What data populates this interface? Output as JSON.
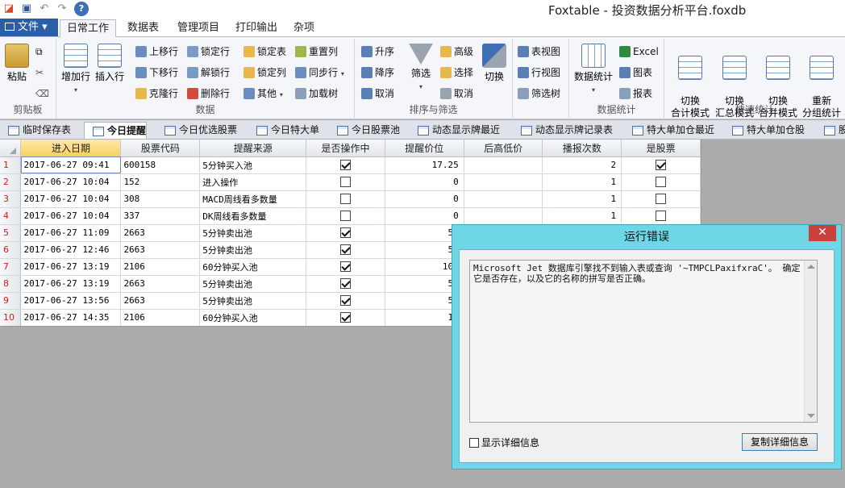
{
  "window": {
    "title": "Foxtable - 投资数据分析平台.foxdb"
  },
  "quick_access": {
    "icons": [
      "app-icon",
      "save-icon",
      "undo-icon",
      "redo-icon",
      "help-icon"
    ]
  },
  "ribbon_tabs": {
    "file": "文件",
    "tabs": [
      "日常工作",
      "数据表",
      "管理项目",
      "打印输出",
      "杂项"
    ],
    "active": "日常工作"
  },
  "ribbon": {
    "clipboard": {
      "label": "剪贴板",
      "paste": "粘贴"
    },
    "data": {
      "label": "数据",
      "add_row": "增加行",
      "insert_row": "插入行",
      "move_up": "上移行",
      "move_down": "下移行",
      "clone_row": "克隆行",
      "lock_row": "锁定行",
      "unlock_row": "解锁行",
      "delete_row": "删除行",
      "lock_table": "锁定表",
      "lock_col": "锁定列",
      "other": "其他",
      "reset_col": "重置列",
      "sync_row": "同步行",
      "load_tree": "加载树"
    },
    "sort_filter": {
      "label": "排序与筛选",
      "asc": "升序",
      "desc": "降序",
      "cancel": "取消",
      "filter": "筛选",
      "advanced": "高级",
      "select": "选择",
      "cancel2": "取消",
      "toggle": "切换"
    },
    "views": {
      "table_view": "表视图",
      "row_view": "行视图",
      "filter_tree": "筛选树"
    },
    "stats": {
      "label": "数据统计",
      "data_stats": "数据统计",
      "excel": "Excel",
      "chart": "图表",
      "report": "报表"
    },
    "quick_stats": {
      "label": "快速统计",
      "total_mode": "切换\n合计模式",
      "summary_mode": "切换\n汇总模式",
      "merge_mode": "切换\n合并模式",
      "regroup": "重新\n分组统计"
    }
  },
  "doc_tabs": [
    "临时保存表",
    "今日提醒",
    "今日优选股票",
    "今日特大单",
    "今日股票池",
    "动态显示牌最近",
    "动态显示牌记录表",
    "特大单加仓最近",
    "特大单加仓股",
    "股"
  ],
  "doc_tab_active": "今日提醒",
  "grid": {
    "columns": [
      "进入日期",
      "股票代码",
      "提醒来源",
      "是否操作中",
      "提醒价位",
      "后高低价",
      "播报次数",
      "是股票"
    ],
    "rows": [
      {
        "n": "1",
        "date": "2017-06-27 09:41",
        "code": "600158",
        "source": "5分钟买入池",
        "op": true,
        "price": "17.25",
        "hl": "",
        "count": "2",
        "stock": true
      },
      {
        "n": "2",
        "date": "2017-06-27 10:04",
        "code": "152",
        "source": "进入操作",
        "op": false,
        "price": "0",
        "hl": "",
        "count": "1",
        "stock": false
      },
      {
        "n": "3",
        "date": "2017-06-27 10:04",
        "code": "308",
        "source": "MACD周线看多数量",
        "op": false,
        "price": "0",
        "hl": "",
        "count": "1",
        "stock": false
      },
      {
        "n": "4",
        "date": "2017-06-27 10:04",
        "code": "337",
        "source": "DK周线看多数量",
        "op": false,
        "price": "0",
        "hl": "",
        "count": "1",
        "stock": false
      },
      {
        "n": "5",
        "date": "2017-06-27 11:09",
        "code": "2663",
        "source": "5分钟卖出池",
        "op": true,
        "price": "5.",
        "hl": "",
        "count": "",
        "stock": null
      },
      {
        "n": "6",
        "date": "2017-06-27 12:46",
        "code": "2663",
        "source": "5分钟卖出池",
        "op": true,
        "price": "5.",
        "hl": "",
        "count": "",
        "stock": null
      },
      {
        "n": "7",
        "date": "2017-06-27 13:19",
        "code": "2106",
        "source": "60分钟买入池",
        "op": true,
        "price": "10.",
        "hl": "",
        "count": "",
        "stock": null
      },
      {
        "n": "8",
        "date": "2017-06-27 13:19",
        "code": "2663",
        "source": "5分钟卖出池",
        "op": true,
        "price": "5.",
        "hl": "",
        "count": "",
        "stock": null
      },
      {
        "n": "9",
        "date": "2017-06-27 13:56",
        "code": "2663",
        "source": "5分钟卖出池",
        "op": true,
        "price": "5.",
        "hl": "",
        "count": "",
        "stock": null
      },
      {
        "n": "10",
        "date": "2017-06-27 14:35",
        "code": "2106",
        "source": "60分钟买入池",
        "op": true,
        "price": "10",
        "hl": "",
        "count": "",
        "stock": null
      }
    ]
  },
  "dialog": {
    "title": "运行错误",
    "close": "✕",
    "message": "Microsoft Jet 数据库引擎找不到输入表或查询 '~TMPCLPaxifxraC'。 确定它是否存在，以及它的名称的拼写是否正确。",
    "show_details": "显示详细信息",
    "copy_details": "复制详细信息"
  },
  "colors": {
    "file_button": "#2a5fa8",
    "dialog_frame": "#6fd6e6",
    "close_button": "#c9413a",
    "row_number": "#c81e1e",
    "selected_header": "#f8d060"
  }
}
